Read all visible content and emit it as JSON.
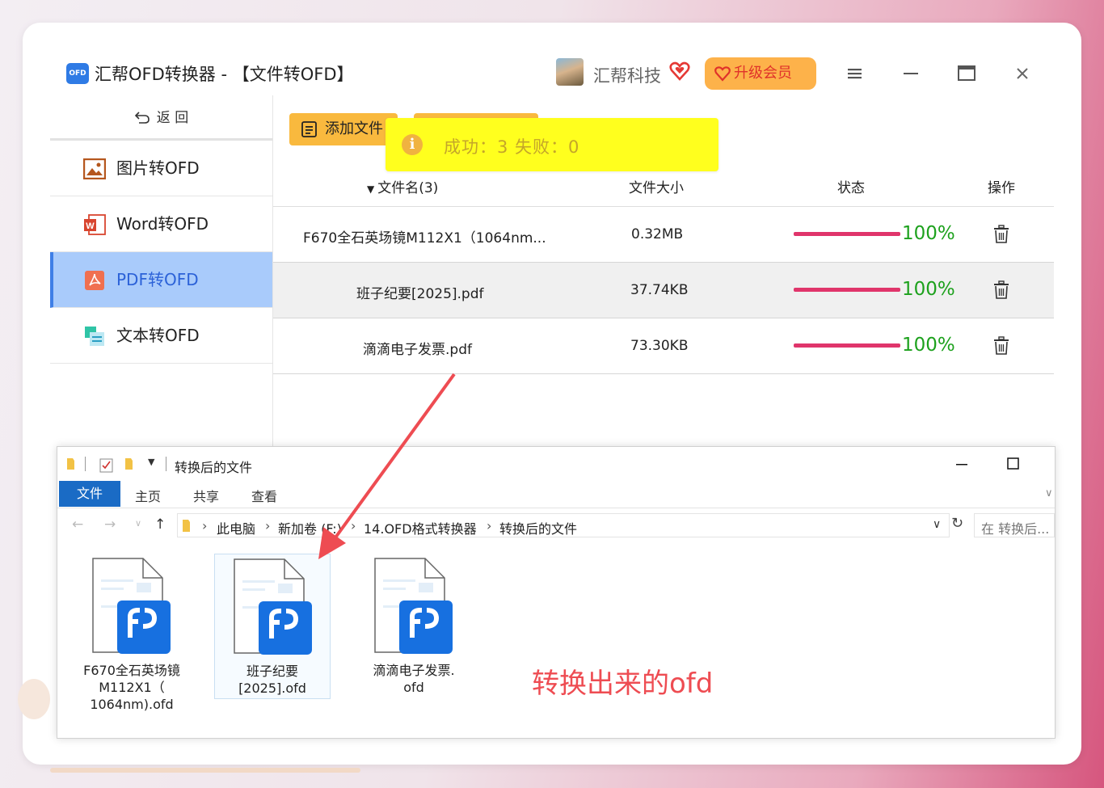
{
  "app": {
    "logo_text": "OFD",
    "title": "汇帮OFD转换器 - 【文件转OFD】",
    "company": "汇帮科技",
    "vip_label": "升级会员"
  },
  "sidebar": {
    "back_label": "返  回",
    "items": [
      {
        "label": "图片转OFD",
        "icon": "image-icon"
      },
      {
        "label": "Word转OFD",
        "icon": "word-icon"
      },
      {
        "label": "PDF转OFD",
        "icon": "pdf-icon",
        "active": true
      },
      {
        "label": "文本转OFD",
        "icon": "text-icon"
      }
    ]
  },
  "toolbar": {
    "add_file_label": "添加文件"
  },
  "toast": {
    "text": "成功：3  失败：0"
  },
  "table": {
    "headers": {
      "name": "文件名(3)",
      "size": "文件大小",
      "status": "状态",
      "action": "操作"
    },
    "rows": [
      {
        "name": "F670全石英场镜M112X1（1064nm...",
        "size": "0.32MB",
        "progress": "100%"
      },
      {
        "name": "班子纪要[2025].pdf",
        "size": "37.74KB",
        "progress": "100%"
      },
      {
        "name": "滴滴电子发票.pdf",
        "size": "73.30KB",
        "progress": "100%"
      }
    ]
  },
  "explorer": {
    "title": "转换后的文件",
    "ribbon_tabs": [
      "文件",
      "主页",
      "共享",
      "查看"
    ],
    "breadcrumb": [
      "此电脑",
      "新加卷 (F:)",
      "14.OFD格式转换器",
      "转换后的文件"
    ],
    "search_placeholder": "在 转换后...",
    "files": [
      {
        "name_lines": [
          "F670全石英场镜",
          "M112X1（",
          "1064nm).ofd"
        ]
      },
      {
        "name_lines": [
          "班子纪要",
          "[2025].ofd"
        ],
        "selected": true
      },
      {
        "name_lines": [
          "滴滴电子发票.",
          "ofd"
        ]
      }
    ]
  },
  "annotation": "转换出来的ofd",
  "colors": {
    "accent_blue": "#2c62d8",
    "sidebar_active_bg": "#a9cbfb",
    "button_yellow": "#f9b93e",
    "toast_bg": "#ffff1e",
    "progress_bar": "#e0356b",
    "progress_text": "#1da11d",
    "annotation_red": "#ee4c52"
  }
}
